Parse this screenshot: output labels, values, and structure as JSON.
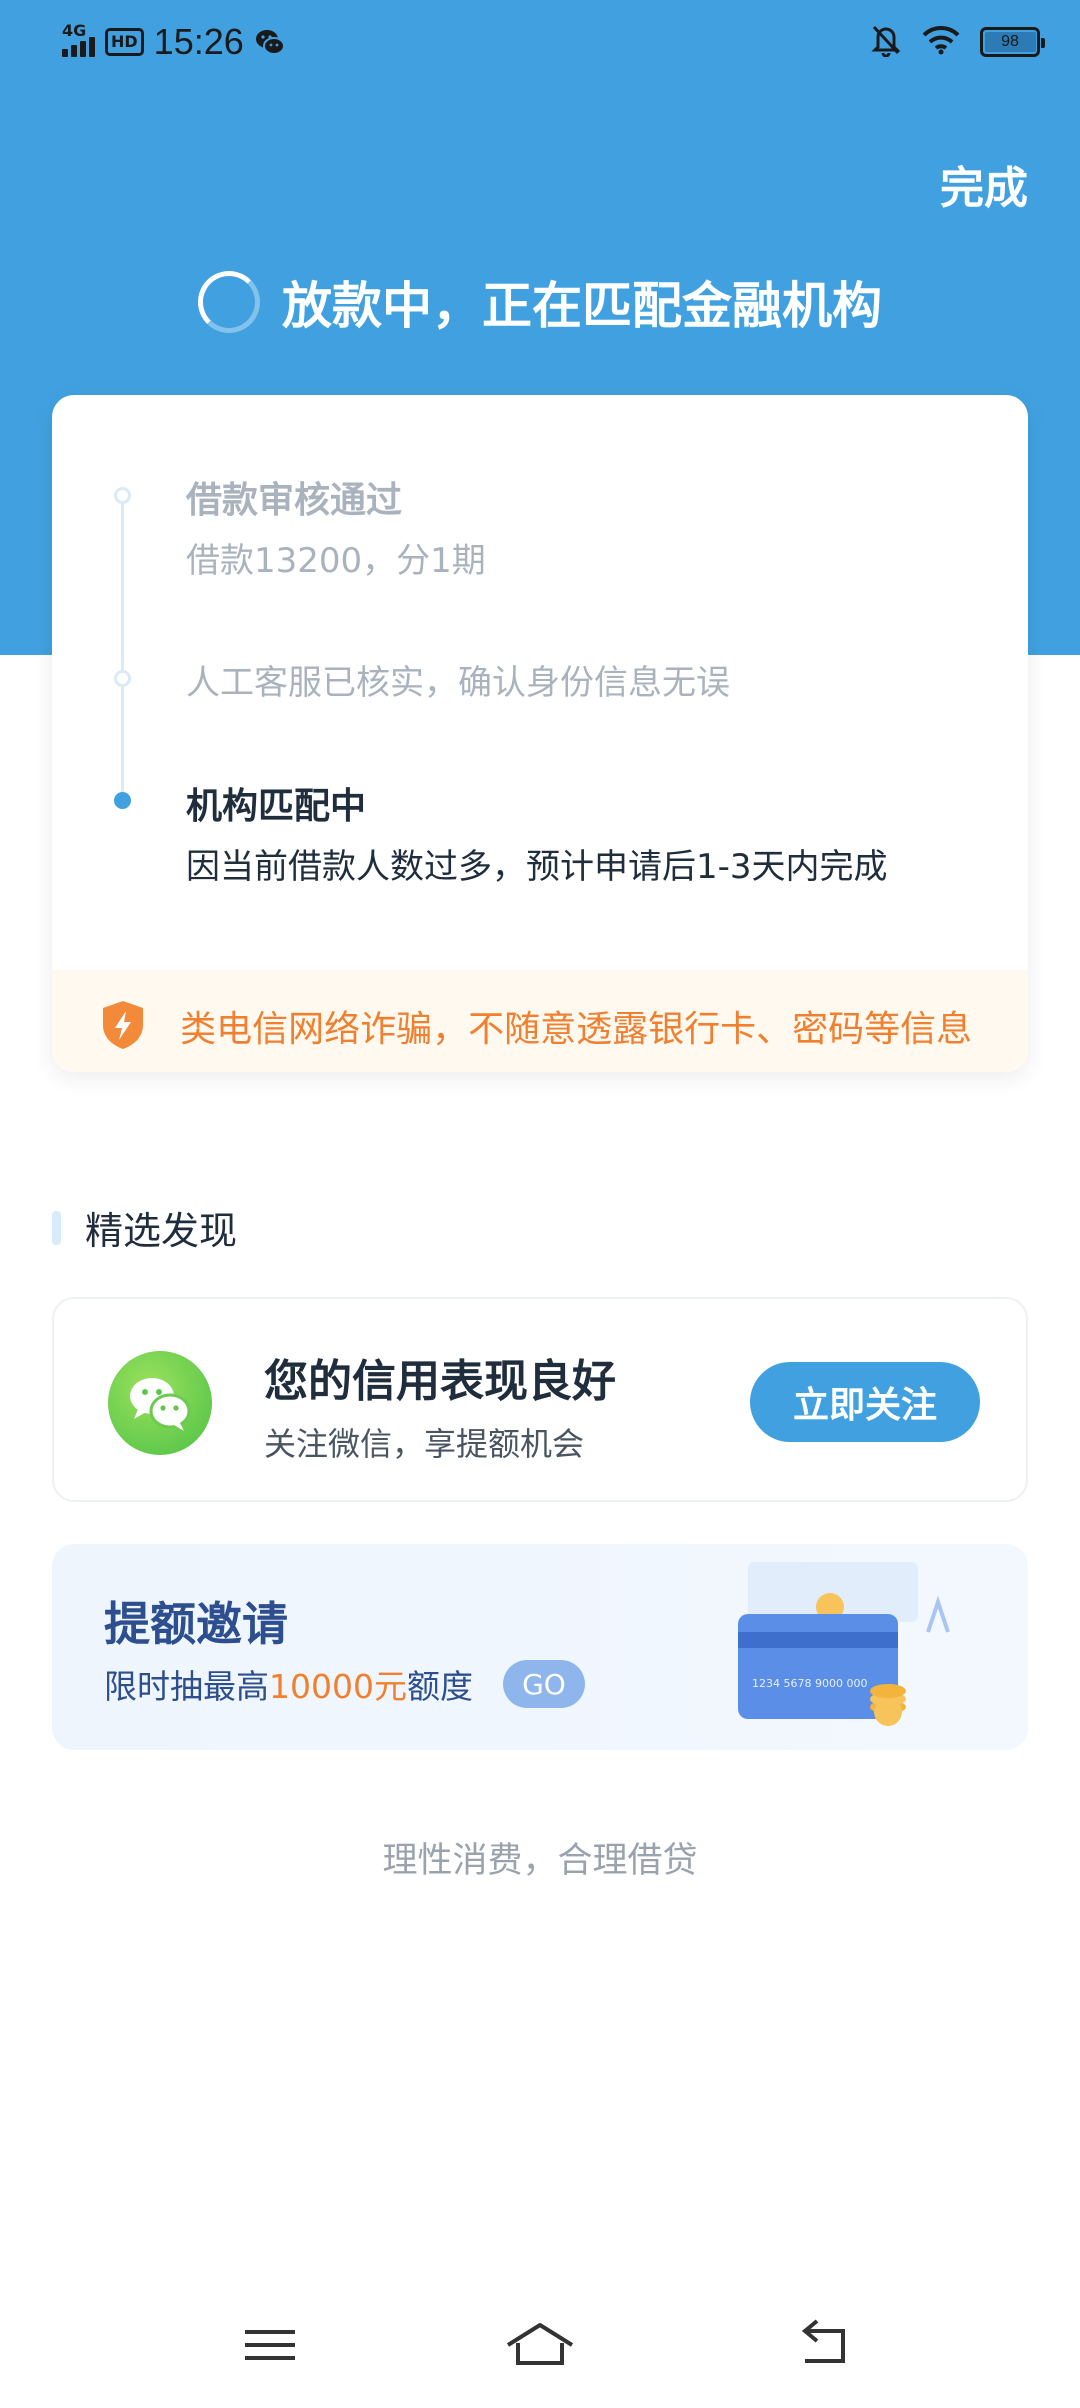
{
  "status_bar": {
    "network": "4G",
    "hd": "HD",
    "time": "15:26",
    "battery": "98",
    "battery_level": 0.98,
    "icons": [
      "signal-icon",
      "wechat-notification-icon",
      "mute-bell-icon",
      "wifi-icon",
      "battery-icon"
    ]
  },
  "header": {
    "done_label": "完成",
    "loading_text": "放款中，正在匹配金融机构",
    "background_color": "#41a1e0"
  },
  "progress": {
    "steps": [
      {
        "title": "借款审核通过",
        "desc": "借款13200，分1期",
        "state": "done"
      },
      {
        "title": "人工客服已核实，确认身份信息无误",
        "desc": "",
        "state": "done"
      },
      {
        "title": "机构匹配中",
        "desc": "因当前借款人数过多，预计申请后1-3天内完成",
        "state": "current"
      }
    ],
    "notice": "谨防各类电信网络诈骗，不随意透露银行卡、密码等信息",
    "notice_visible": ";类电信网络诈骗，不随意透露银行卡、密码等信息",
    "notice_color": "#f08030"
  },
  "discover": {
    "section_title": "精选发现",
    "wechat_card": {
      "title": "您的信用表现良好",
      "subtitle": "关注微信，享提额机会",
      "button_label": "立即关注"
    },
    "invite_card": {
      "title": "提额邀请",
      "sub_prefix": "限时抽最高",
      "sub_amount": "10000元",
      "sub_suffix": "额度",
      "go_label": "GO",
      "card_number": "1234 5678 9000 000"
    }
  },
  "footer": {
    "slogan": "理性消费，合理借贷"
  },
  "nav": {
    "icons": [
      "menu-icon",
      "home-icon",
      "back-icon"
    ]
  }
}
